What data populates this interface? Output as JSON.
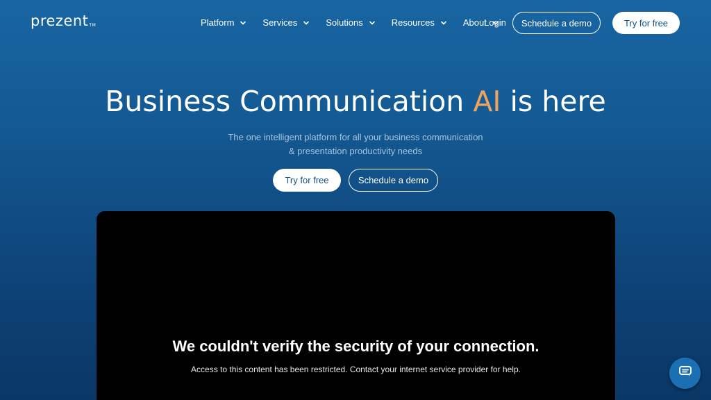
{
  "brand": {
    "name": "prezent",
    "tm": "TM"
  },
  "nav": {
    "items": [
      {
        "label": "Platform"
      },
      {
        "label": "Services"
      },
      {
        "label": "Solutions"
      },
      {
        "label": "Resources"
      },
      {
        "label": "About"
      }
    ],
    "login": "Login",
    "schedule_demo": "Schedule a demo",
    "try_free": "Try for free"
  },
  "hero": {
    "title_before": "Business Communication ",
    "title_accent": "AI",
    "title_after": " is here",
    "subtitle_line1": "The one intelligent platform for all your business communication",
    "subtitle_line2": "& presentation productivity needs",
    "cta_try": "Try for free",
    "cta_demo": "Schedule a demo"
  },
  "video_error": {
    "title": "We couldn't verify the security of your connection.",
    "message": "Access to this content has been restricted. Contact your internet service provider for help."
  },
  "colors": {
    "accent": "#f0a35e",
    "background": "#145a93",
    "button_text": "#0f4f86"
  },
  "icons": {
    "dropdown": "chevron-down-icon",
    "chat": "chat-icon"
  }
}
